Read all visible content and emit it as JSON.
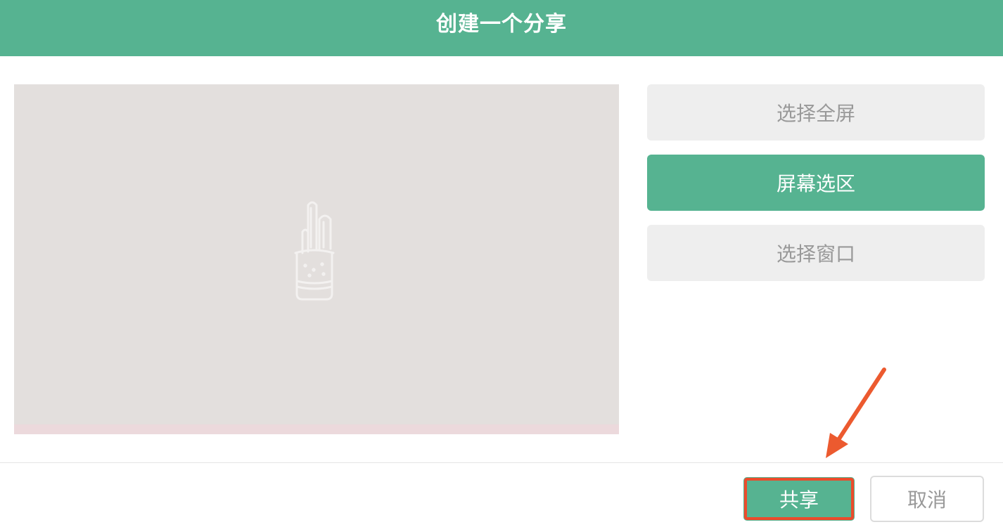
{
  "dialog": {
    "title": "创建一个分享"
  },
  "options": {
    "fullscreen_label": "选择全屏",
    "region_label": "屏幕选区",
    "window_label": "选择窗口",
    "selected": "屏幕选区"
  },
  "footer": {
    "share_label": "共享",
    "cancel_label": "取消"
  },
  "preview": {
    "icon": "cactus-pot-icon"
  },
  "colors": {
    "accent": "#56b391",
    "highlight": "#ec4b2c",
    "preview_bg": "#e3dfdd"
  }
}
